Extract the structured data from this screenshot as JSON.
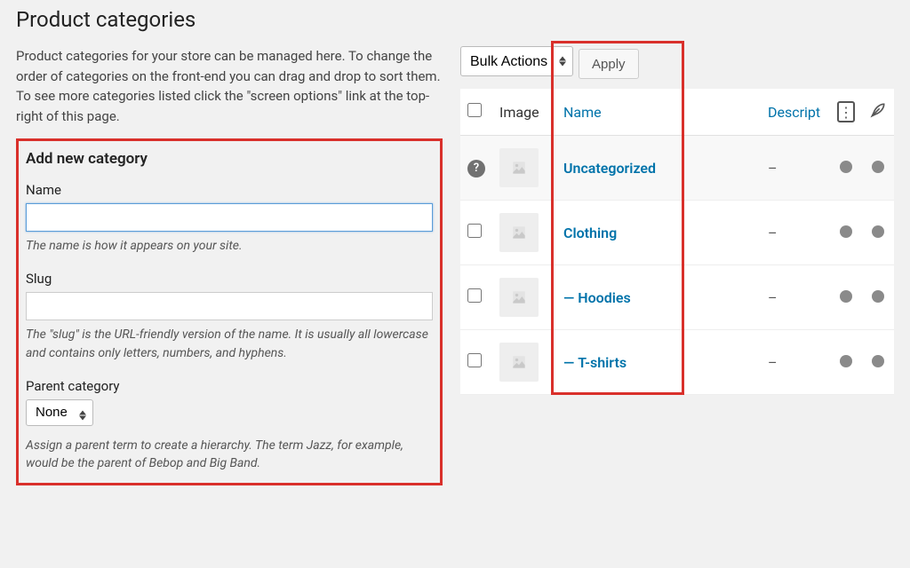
{
  "page": {
    "title": "Product categories",
    "intro": "Product categories for your store can be managed here. To change the order of categories on the front-end you can drag and drop to sort them. To see more categories listed click the \"screen options\" link at the top-right of this page."
  },
  "form": {
    "title": "Add new category",
    "name_label": "Name",
    "name_value": "",
    "name_help": "The name is how it appears on your site.",
    "slug_label": "Slug",
    "slug_value": "",
    "slug_help": "The \"slug\" is the URL-friendly version of the name. It is usually all lowercase and contains only letters, numbers, and hyphens.",
    "parent_label": "Parent category",
    "parent_value": "None",
    "parent_help": "Assign a parent term to create a hierarchy. The term Jazz, for example, would be the parent of Bebop and Big Band."
  },
  "bulk": {
    "select_label": "Bulk Actions",
    "apply_label": "Apply"
  },
  "table": {
    "headers": {
      "image": "Image",
      "name": "Name",
      "description": "Descript"
    },
    "rows": [
      {
        "name": "Uncategorized",
        "description": "–",
        "indent": 0,
        "selectable": false
      },
      {
        "name": "Clothing",
        "description": "–",
        "indent": 0,
        "selectable": true
      },
      {
        "name": "Hoodies",
        "description": "–",
        "indent": 1,
        "selectable": true
      },
      {
        "name": "T-shirts",
        "description": "–",
        "indent": 1,
        "selectable": true
      }
    ]
  }
}
